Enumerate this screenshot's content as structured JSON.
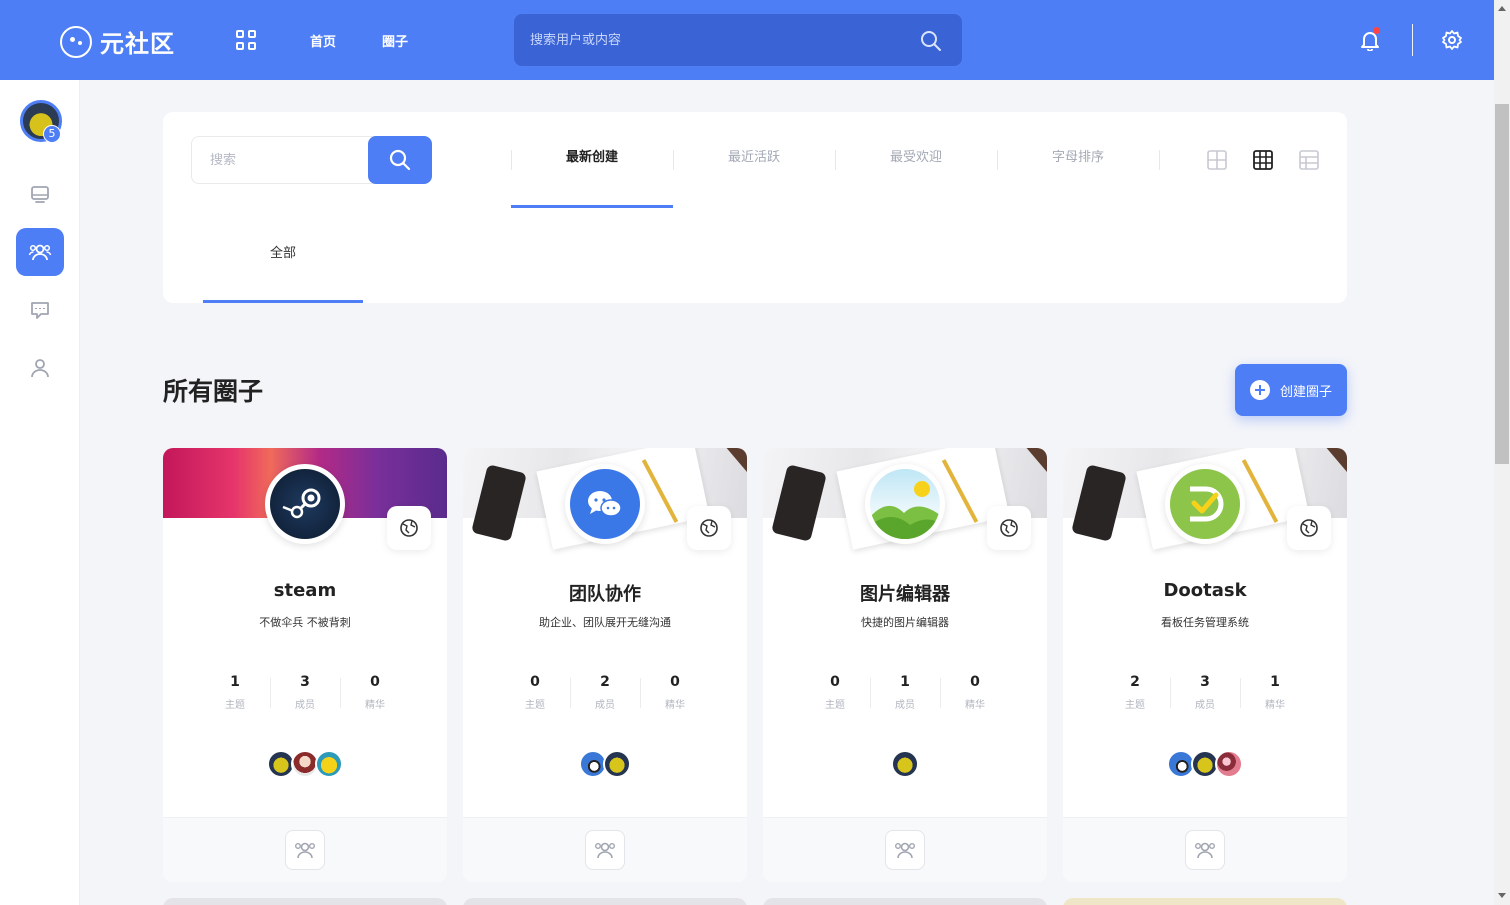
{
  "app": {
    "name": "元社区"
  },
  "nav": {
    "home": "首页",
    "circles": "圈子"
  },
  "top_search": {
    "placeholder": "搜索用户或内容"
  },
  "sidebar": {
    "badge": "5"
  },
  "filter": {
    "search_placeholder": "搜索",
    "sort_tabs": [
      "最新创建",
      "最近活跃",
      "最受欢迎",
      "字母排序"
    ],
    "active_sort": 0,
    "categories": [
      "全部"
    ]
  },
  "section": {
    "title": "所有圈子",
    "create_label": "创建圈子"
  },
  "cards": [
    {
      "name": "steam",
      "desc": "不做伞兵 不被背刺",
      "topics": "1",
      "members_count": "3",
      "featured": "0",
      "labels": [
        "主题",
        "成员",
        "精华"
      ]
    },
    {
      "name": "团队协作",
      "desc": "助企业、团队展开无缝沟通",
      "topics": "0",
      "members_count": "2",
      "featured": "0",
      "labels": [
        "主题",
        "成员",
        "精华"
      ]
    },
    {
      "name": "图片编辑器",
      "desc": "快捷的图片编辑器",
      "topics": "0",
      "members_count": "1",
      "featured": "0",
      "labels": [
        "主题",
        "成员",
        "精华"
      ]
    },
    {
      "name": "Dootask",
      "desc": "看板任务管理系统",
      "topics": "2",
      "members_count": "3",
      "featured": "1",
      "labels": [
        "主题",
        "成员",
        "精华"
      ]
    }
  ],
  "colors": {
    "accent": "#4e7ef5",
    "notification_dot": "#ff4444"
  },
  "icons": [
    "apps-icon",
    "search-icon",
    "bell-icon",
    "gear-icon",
    "monitor-icon",
    "group-icon",
    "chat-icon",
    "user-icon",
    "globe-icon",
    "view-card-icon",
    "view-grid-icon",
    "view-list-icon",
    "plus-icon",
    "join-icon"
  ]
}
